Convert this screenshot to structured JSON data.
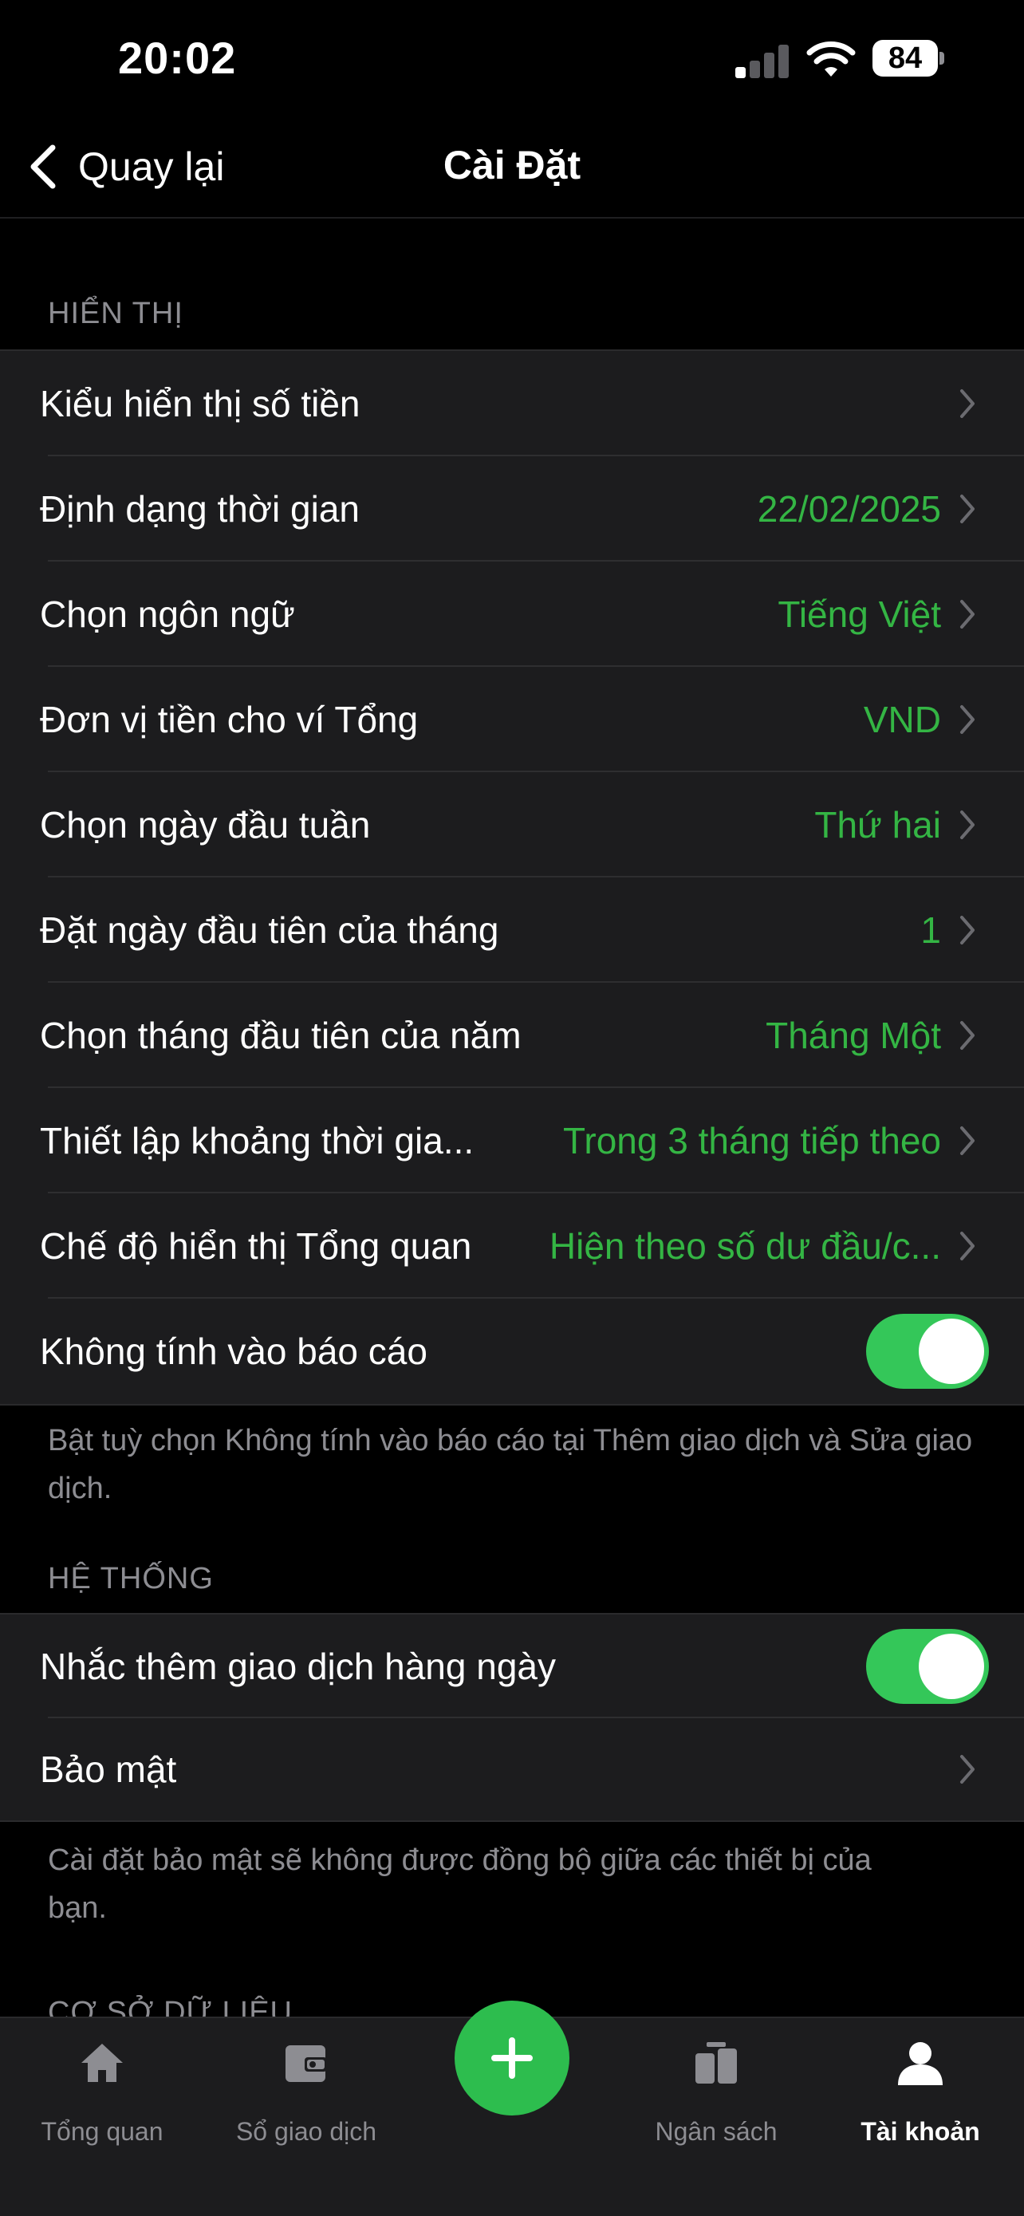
{
  "status_bar": {
    "time": "20:02",
    "battery": "84",
    "icons": [
      "signal-icon",
      "wifi-icon",
      "battery-icon"
    ]
  },
  "nav": {
    "back_label": "Quay lại",
    "title": "Cài Đặt"
  },
  "colors": {
    "accent_green": "#34b544",
    "toggle_on": "#34c759",
    "row_bg": "#1c1c1e",
    "muted_text": "#8d8d92"
  },
  "display_section": {
    "header": "HIỂN THỊ",
    "rows": [
      {
        "label": "Kiểu hiển thị số tiền",
        "value": ""
      },
      {
        "label": "Định dạng thời gian",
        "value": "22/02/2025"
      },
      {
        "label": "Chọn ngôn ngữ",
        "value": "Tiếng Việt"
      },
      {
        "label": "Đơn vị tiền cho ví Tổng",
        "value": "VND"
      },
      {
        "label": "Chọn ngày đầu tuần",
        "value": "Thứ hai"
      },
      {
        "label": "Đặt ngày đầu tiên của tháng",
        "value": "1"
      },
      {
        "label": "Chọn tháng đầu tiên của năm",
        "value": "Tháng Một"
      },
      {
        "label": "Thiết lập khoảng thời gia...",
        "value": "Trong 3 tháng tiếp theo"
      },
      {
        "label": "Chế độ hiển thị Tổng quan",
        "value": "Hiện theo số dư đầu/c..."
      }
    ],
    "toggle_row": {
      "label": "Không tính vào báo cáo",
      "on": true
    },
    "footnote": "Bật tuỳ chọn Không tính vào báo cáo tại Thêm giao dịch và Sửa giao dịch."
  },
  "system_section": {
    "header": "HỆ THỐNG",
    "toggle_row": {
      "label": "Nhắc thêm giao dịch hàng ngày",
      "on": true
    },
    "security_row": {
      "label": "Bảo mật"
    },
    "footnote": "Cài đặt bảo mật sẽ không được đồng bộ giữa các thiết bị của bạn."
  },
  "database_section": {
    "header": "CƠ SỞ DỮ LIỆU"
  },
  "tab_bar": {
    "tabs": [
      {
        "label": "Tổng quan",
        "icon": "home-icon",
        "active": false
      },
      {
        "label": "Sổ giao dịch",
        "icon": "wallet-icon",
        "active": false
      },
      {
        "label": "Ngân sách",
        "icon": "budget-icon",
        "active": false
      },
      {
        "label": "Tài khoản",
        "icon": "person-icon",
        "active": true
      }
    ],
    "fab_icon": "plus-icon"
  }
}
